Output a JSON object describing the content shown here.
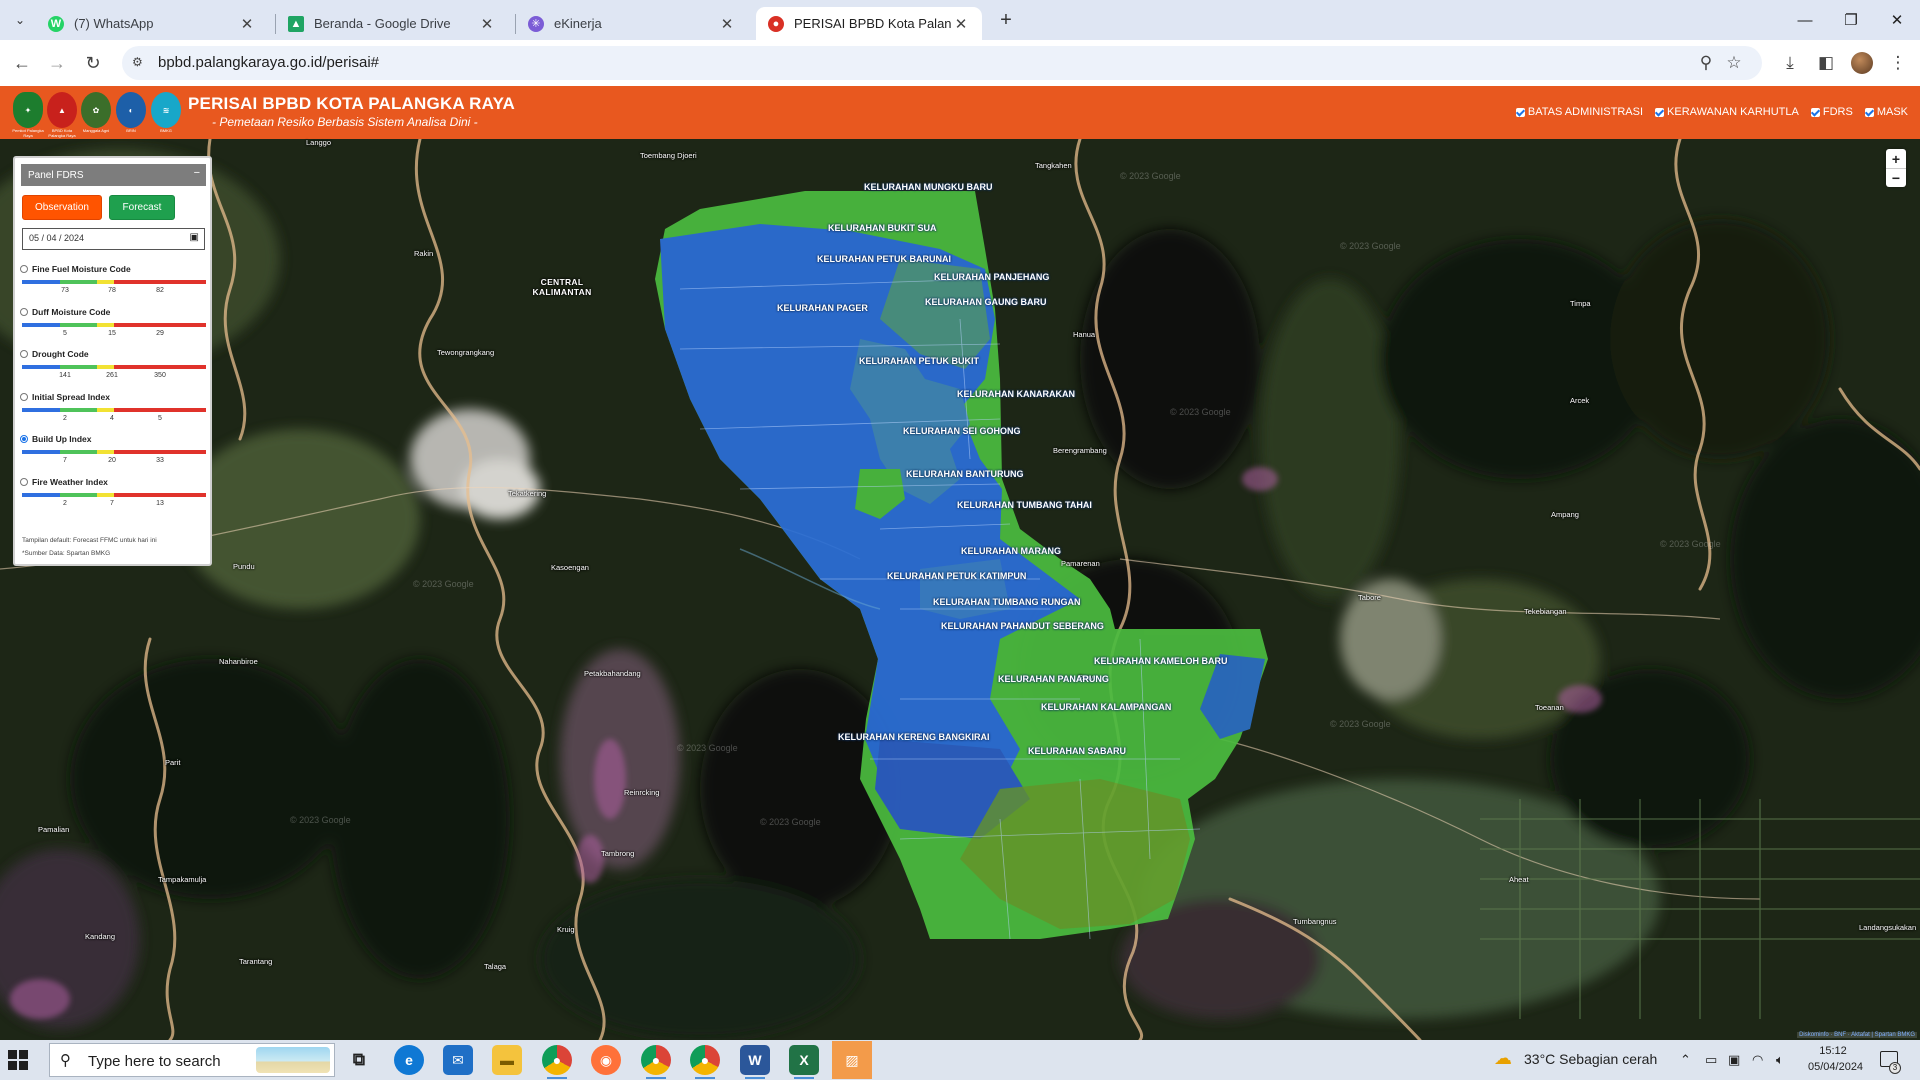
{
  "browser": {
    "tabs": [
      {
        "title": "(7) WhatsApp",
        "icon": "whatsapp-icon",
        "color": "#25d366",
        "glyph": "W"
      },
      {
        "title": "Beranda - Google Drive",
        "icon": "google-drive-icon",
        "color": "#1fa463",
        "glyph": "▲"
      },
      {
        "title": "eKinerja",
        "icon": "ekinerja-icon",
        "color": "#7b5cd6",
        "glyph": "✳"
      },
      {
        "title": "PERISAI BPBD Kota Palangka Ra",
        "icon": "perisai-icon",
        "color": "#d93025",
        "glyph": "●"
      }
    ],
    "url": "bpbd.palangkaraya.go.id/perisai#"
  },
  "header": {
    "title": "PERISAI BPBD KOTA PALANGKA RAYA",
    "subtitle": "- Pemetaan Resiko Berbasis Sistem Analisa Dini -",
    "logos": [
      {
        "name": "kota-palangka-raya-logo",
        "color": "#1d7d2e",
        "caption": "Pemkot Palangka Raya"
      },
      {
        "name": "bpbd-logo",
        "color": "#c8211c",
        "caption": "BPBD Kota Palangka Raya"
      },
      {
        "name": "manggala-agni-logo",
        "color": "#3b6e2a",
        "caption": "Manggala Agni"
      },
      {
        "name": "brin-logo",
        "color": "#1d5fa8",
        "caption": "BRIN"
      },
      {
        "name": "bmkg-logo",
        "color": "#18a7c9",
        "caption": "BMKG"
      }
    ],
    "layers": [
      "BATAS ADMINISTRASI",
      "KERAWANAN KARHUTLA",
      "FDRS",
      "MASK"
    ]
  },
  "panel": {
    "title": "Panel FDRS",
    "minimize": "−",
    "observation_label": "Observation",
    "forecast_label": "Forecast",
    "date": "05 / 04 / 2024",
    "indices": [
      {
        "name": "Fine Fuel Moisture Code",
        "ticks": [
          "73",
          "78",
          "82"
        ],
        "selected": false
      },
      {
        "name": "Duff Moisture Code",
        "ticks": [
          "5",
          "15",
          "29"
        ],
        "selected": false
      },
      {
        "name": "Drought Code",
        "ticks": [
          "141",
          "261",
          "350"
        ],
        "selected": false
      },
      {
        "name": "Initial Spread Index",
        "ticks": [
          "2",
          "4",
          "5"
        ],
        "selected": false
      },
      {
        "name": "Build Up Index",
        "ticks": [
          "7",
          "20",
          "33"
        ],
        "selected": true
      },
      {
        "name": "Fire Weather Index",
        "ticks": [
          "2",
          "7",
          "13"
        ],
        "selected": false
      }
    ],
    "scale_colors": [
      "#2f6fe0",
      "#4fc35a",
      "#f2e233",
      "#e0322b"
    ],
    "note1": "Tampilan default: Forecast FFMC untuk hari ini",
    "note2": "*Sumber Data: Spartan BMKG"
  },
  "map": {
    "kelurahan": [
      "KELURAHAN MUNGKU BARU",
      "KELURAHAN BUKIT SUA",
      "KELURAHAN PETUK BARUNAI",
      "KELURAHAN PANJEHANG",
      "KELURAHAN GAUNG BARU",
      "KELURAHAN PAGER",
      "KELURAHAN PETUK BUKIT",
      "KELURAHAN KANARAKAN",
      "KELURAHAN SEI GOHONG",
      "KELURAHAN BANTURUNG",
      "KELURAHAN TUMBANG TAHAI",
      "KELURAHAN MARANG",
      "KELURAHAN PETUK KATIMPUN",
      "KELURAHAN TUMBANG RUNGAN",
      "KELURAHAN PAHANDUT SEBERANG",
      "KELURAHAN KAMELOH BARU",
      "KELURAHAN PANARUNG",
      "KELURAHAN KALAMPANGAN",
      "KELURAHAN KERENG BANGKIRAI",
      "KELURAHAN SABARU"
    ],
    "places": [
      "Langgo",
      "Toembang Djoeri",
      "Tangkahen",
      "Rakin",
      "CENTRAL KALIMANTAN",
      "Tewongrangkang",
      "Timpa",
      "Hanua",
      "Arcek",
      "Berengrambang",
      "Tekatkering",
      "Ampang",
      "Pundu",
      "Kasoengan",
      "Pamarenan",
      "Tabore",
      "Tekebiangan",
      "Nahanbiroe",
      "Petakbahandang",
      "Raw",
      "Toeanan",
      "Parit",
      "Reinrcking",
      "Pamalian",
      "Tambrong",
      "Tampakamulja",
      "Aheat",
      "Kandang",
      "Kruig",
      "Tumbangnus",
      "Landangsukakan",
      "Tarantang",
      "Talaga"
    ],
    "watermark": "© 2023 Google",
    "attribution": "Diskominfo · BNF · Aktafat | Spartan BMKG",
    "zoom_in": "+",
    "zoom_out": "−"
  },
  "taskbar": {
    "search_placeholder": "Type here to search",
    "weather": "33°C  Sebagian cerah",
    "time": "15:12",
    "date": "05/04/2024",
    "notifications": "3"
  }
}
